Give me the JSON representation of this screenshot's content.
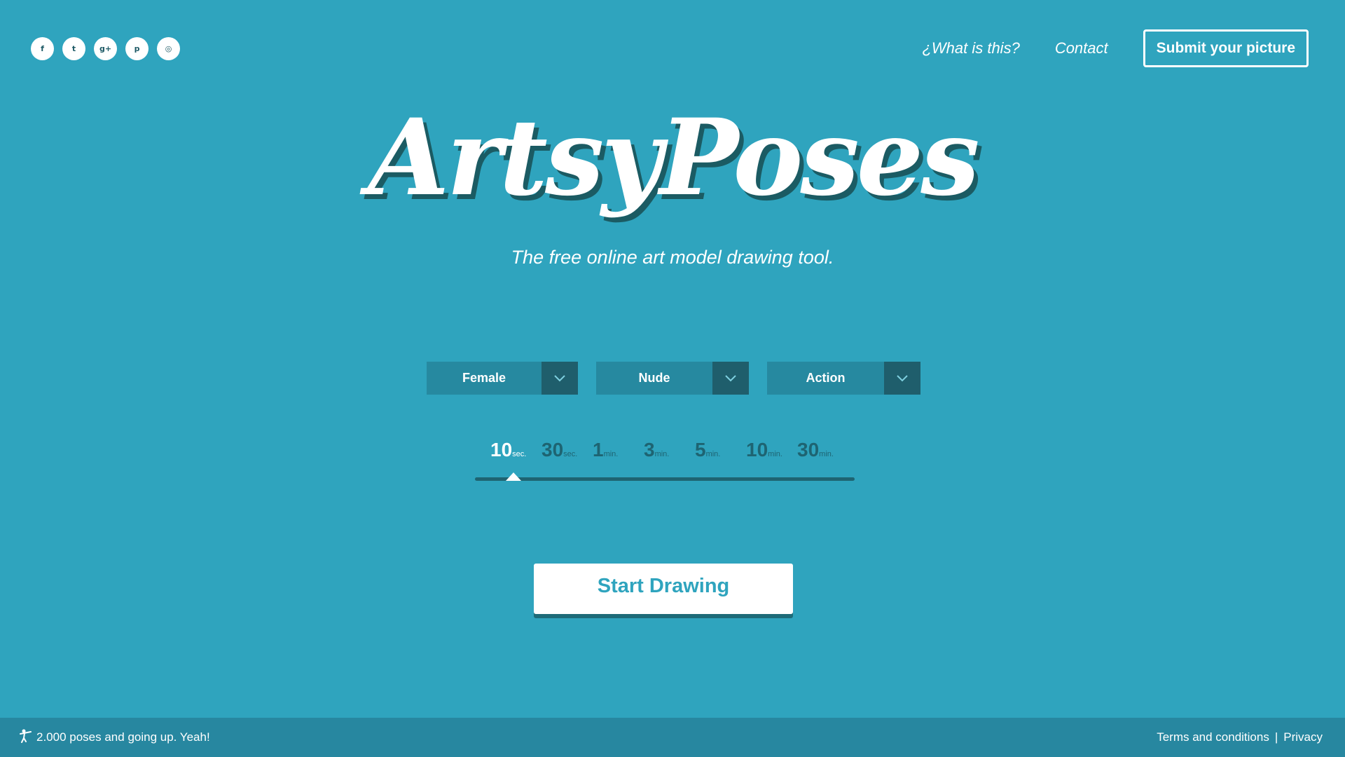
{
  "social": [
    {
      "name": "facebook-icon",
      "glyph": "f"
    },
    {
      "name": "twitter-icon",
      "glyph": "t"
    },
    {
      "name": "google-plus-icon",
      "glyph": "g+"
    },
    {
      "name": "pinterest-icon",
      "glyph": "p"
    },
    {
      "name": "dribbble-icon",
      "glyph": "◎"
    }
  ],
  "nav": {
    "what_is_this": "¿What is this?",
    "contact": "Contact",
    "submit": "Submit your picture"
  },
  "logo": "ArtsyPoses",
  "tagline": "The free online art model drawing tool.",
  "selects": {
    "gender": "Female",
    "clothing": "Nude",
    "pose_type": "Action"
  },
  "times": [
    {
      "num": "10",
      "unit": "sec."
    },
    {
      "num": "30",
      "unit": "sec."
    },
    {
      "num": "1",
      "unit": "min."
    },
    {
      "num": "3",
      "unit": "min."
    },
    {
      "num": "5",
      "unit": "min."
    },
    {
      "num": "10",
      "unit": "min."
    },
    {
      "num": "30",
      "unit": "min."
    }
  ],
  "selected_time_index": 0,
  "start_button": "Start Drawing",
  "footer": {
    "stat": "2.000 poses and going up. Yeah!",
    "terms": "Terms and conditions",
    "separator": "|",
    "privacy": "Privacy"
  },
  "colors": {
    "background": "#2fa4be",
    "footer": "#2787a0",
    "dark_accent": "#1e6472"
  }
}
